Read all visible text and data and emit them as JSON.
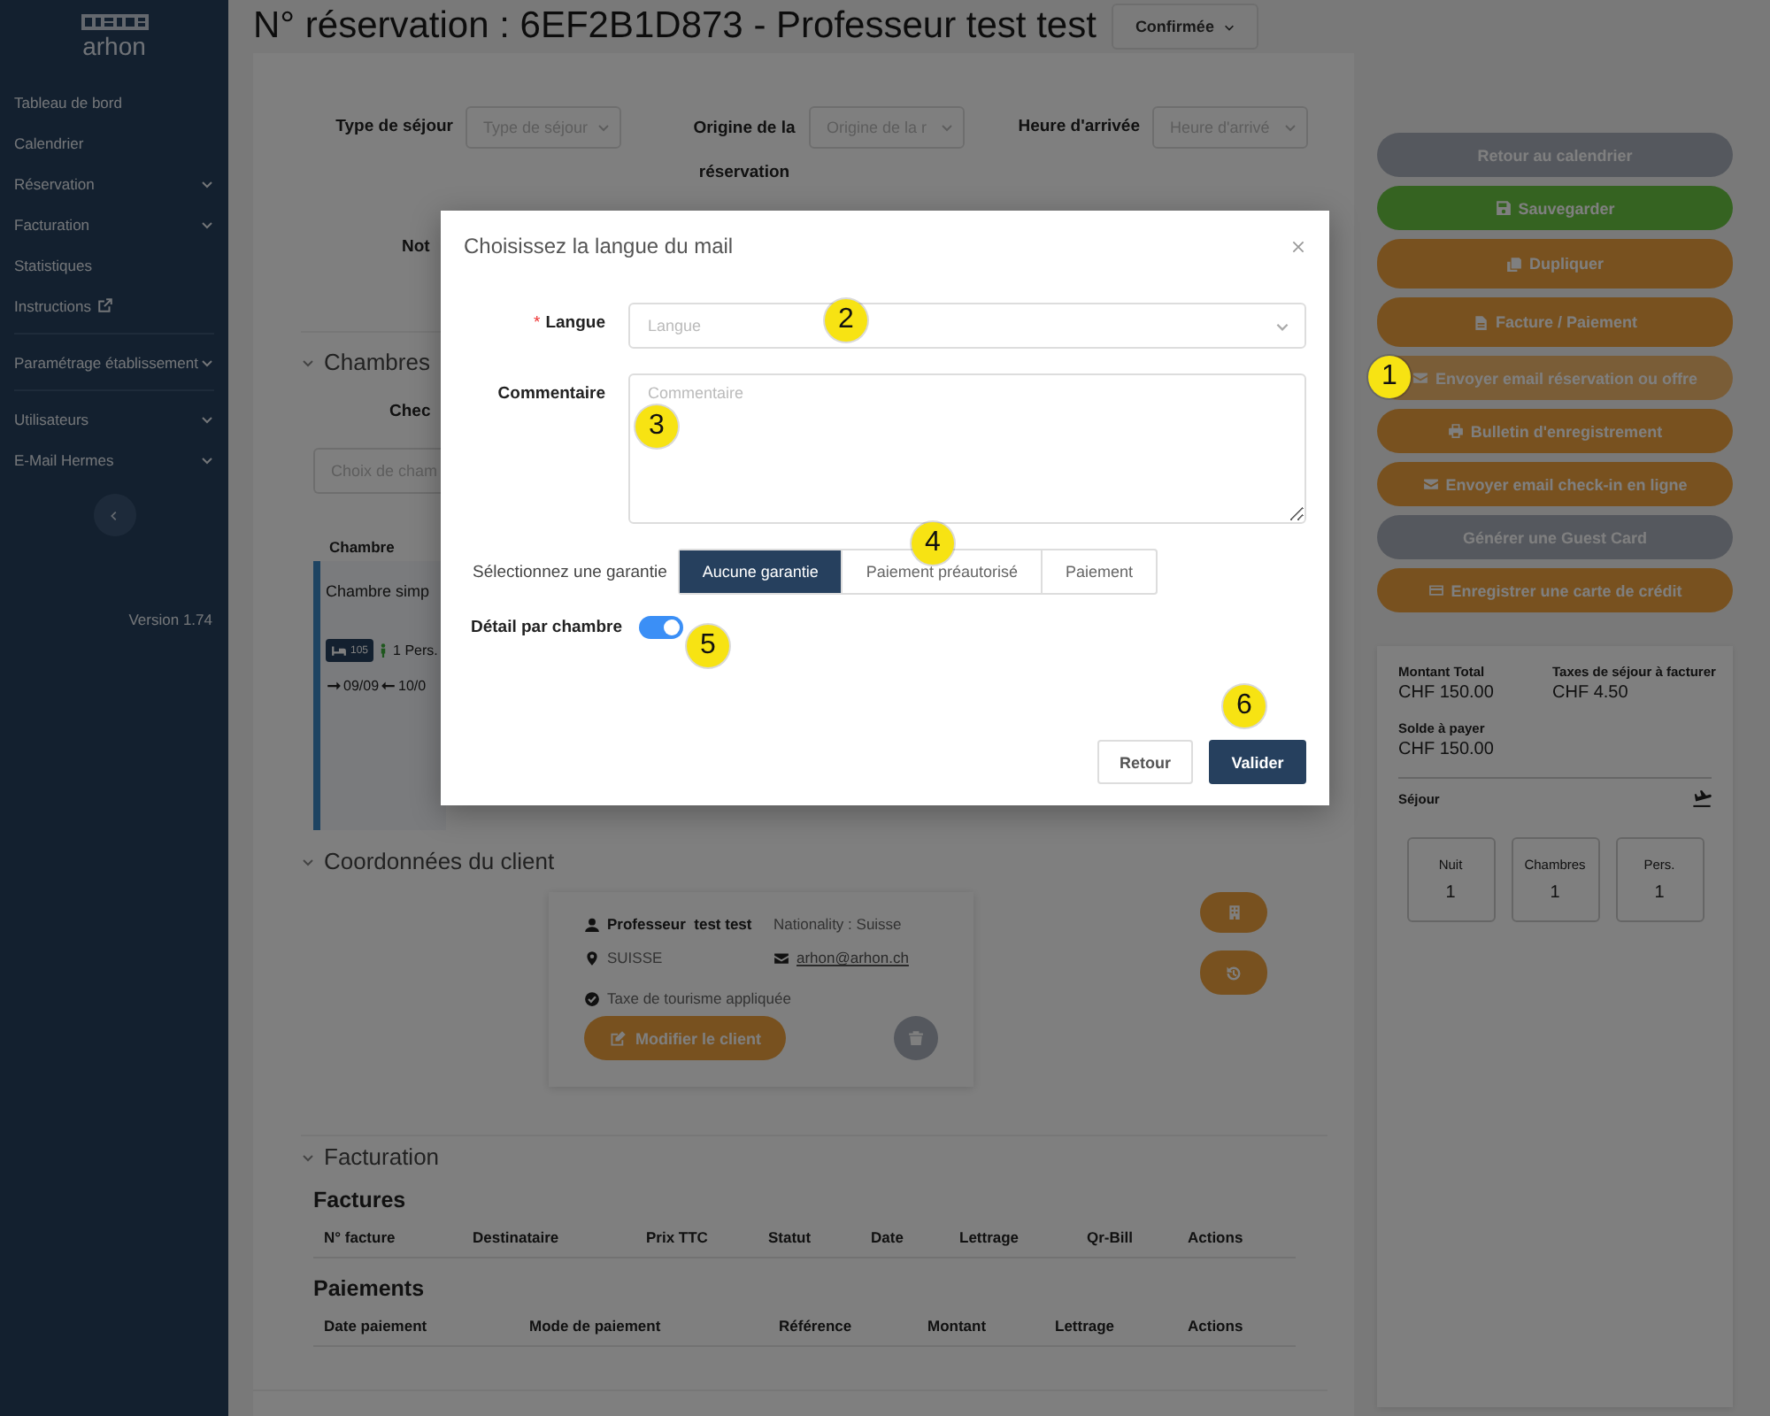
{
  "sidebar": {
    "logo": "arhon",
    "groups": [
      [
        {
          "label": "Tableau de bord",
          "kind": "link"
        },
        {
          "label": "Calendrier",
          "kind": "link"
        },
        {
          "label": "Réservation",
          "kind": "submenu"
        },
        {
          "label": "Facturation",
          "kind": "submenu"
        },
        {
          "label": "Statistiques",
          "kind": "link"
        },
        {
          "label": "Instructions",
          "kind": "external"
        }
      ],
      [
        {
          "label": "Paramétrage établissement",
          "kind": "submenu"
        }
      ],
      [
        {
          "label": "Utilisateurs",
          "kind": "submenu"
        },
        {
          "label": "E-Mail Hermes",
          "kind": "submenu"
        }
      ]
    ],
    "version": "Version 1.74"
  },
  "header": {
    "title": "N° réservation : 6EF2B1D873 - Professeur test test",
    "status": "Confirmée"
  },
  "form": {
    "fields": [
      {
        "label": "Type de séjour",
        "placeholder": "Type de séjour"
      },
      {
        "label": "Origine de la réservation",
        "placeholder": "Origine de la r"
      },
      {
        "label": "Heure d'arrivée",
        "placeholder": "Heure d'arrivé"
      }
    ],
    "note_label": "Not"
  },
  "rooms": {
    "title": "Chambres",
    "expanded": true,
    "check_label": "Chec",
    "search_placeholder": "Choix de cham",
    "column": "Chambre",
    "room": {
      "name": "Chambre simp",
      "number": "105",
      "guests": "1 Pers.",
      "arrival": "09/09",
      "departure": "10/0"
    }
  },
  "client": {
    "title": "Coordonnées du client",
    "expanded": true,
    "name": "Professeur  test test",
    "nationality": "Nationality : Suisse",
    "country": "SUISSE",
    "email": "arhon@arhon.ch",
    "tax": "Taxe de tourisme appliquée",
    "edit_button": "Modifier le client"
  },
  "billing": {
    "title": "Facturation",
    "expanded": true,
    "tables": [
      {
        "title": "Factures",
        "columns": [
          "N° facture",
          "Destinataire",
          "Prix TTC",
          "Statut",
          "Date",
          "Lettrage",
          "Qr-Bill",
          "Actions"
        ]
      },
      {
        "title": "Paiements",
        "columns": [
          "Date paiement",
          "Mode de paiement",
          "Référence",
          "Montant",
          "Lettrage",
          "Actions"
        ]
      }
    ]
  },
  "actions": [
    {
      "label": "Retour au calendrier",
      "kind": "back",
      "highlighted": false
    },
    {
      "label": "Sauvegarder",
      "kind": "save",
      "highlighted": false
    },
    {
      "label": "Dupliquer",
      "kind": "duplicate",
      "highlighted": false
    },
    {
      "label": "Facture / Paiement",
      "kind": "invoice",
      "highlighted": false
    },
    {
      "label": "Envoyer email réservation ou offre",
      "kind": "email",
      "highlighted": true
    },
    {
      "label": "Bulletin d'enregistrement",
      "kind": "print",
      "highlighted": false
    },
    {
      "label": "Envoyer email check-in en ligne",
      "kind": "checkin",
      "highlighted": false
    },
    {
      "label": "Générer une Guest Card",
      "kind": "guestcard",
      "highlighted": false
    },
    {
      "label": "Enregistrer une carte de crédit",
      "kind": "card",
      "highlighted": false
    }
  ],
  "summary": {
    "amounts": [
      {
        "label": "Montant Total",
        "value": "CHF 150.00"
      },
      {
        "label": "Taxes de séjour à facturer",
        "value": "CHF 4.50"
      },
      {
        "label": "Solde à payer",
        "value": "CHF 150.00"
      }
    ],
    "stay_label": "Séjour",
    "counts": [
      {
        "label": "Nuit",
        "value": "1"
      },
      {
        "label": "Chambres",
        "value": "1"
      },
      {
        "label": "Pers.",
        "value": "1"
      }
    ]
  },
  "modal": {
    "title": "Choisissez la langue du mail",
    "required_mark": "*",
    "fields": [
      {
        "label": "Langue",
        "required": true,
        "kind": "select",
        "placeholder": "Langue"
      },
      {
        "label": "Commentaire",
        "required": false,
        "kind": "textarea",
        "placeholder": "Commentaire"
      }
    ],
    "guarantee": {
      "label": "Sélectionnez une garantie",
      "options": [
        {
          "label": "Aucune garantie",
          "selected": true
        },
        {
          "label": "Paiement préautorisé",
          "selected": false
        },
        {
          "label": "Paiement",
          "selected": false
        }
      ]
    },
    "detail_toggle": {
      "label": "Détail par chambre",
      "on": true
    },
    "buttons": [
      {
        "label": "Retour",
        "kind": "secondary"
      },
      {
        "label": "Valider",
        "kind": "primary"
      }
    ]
  },
  "callouts": [
    "1",
    "2",
    "3",
    "4",
    "5",
    "6"
  ]
}
